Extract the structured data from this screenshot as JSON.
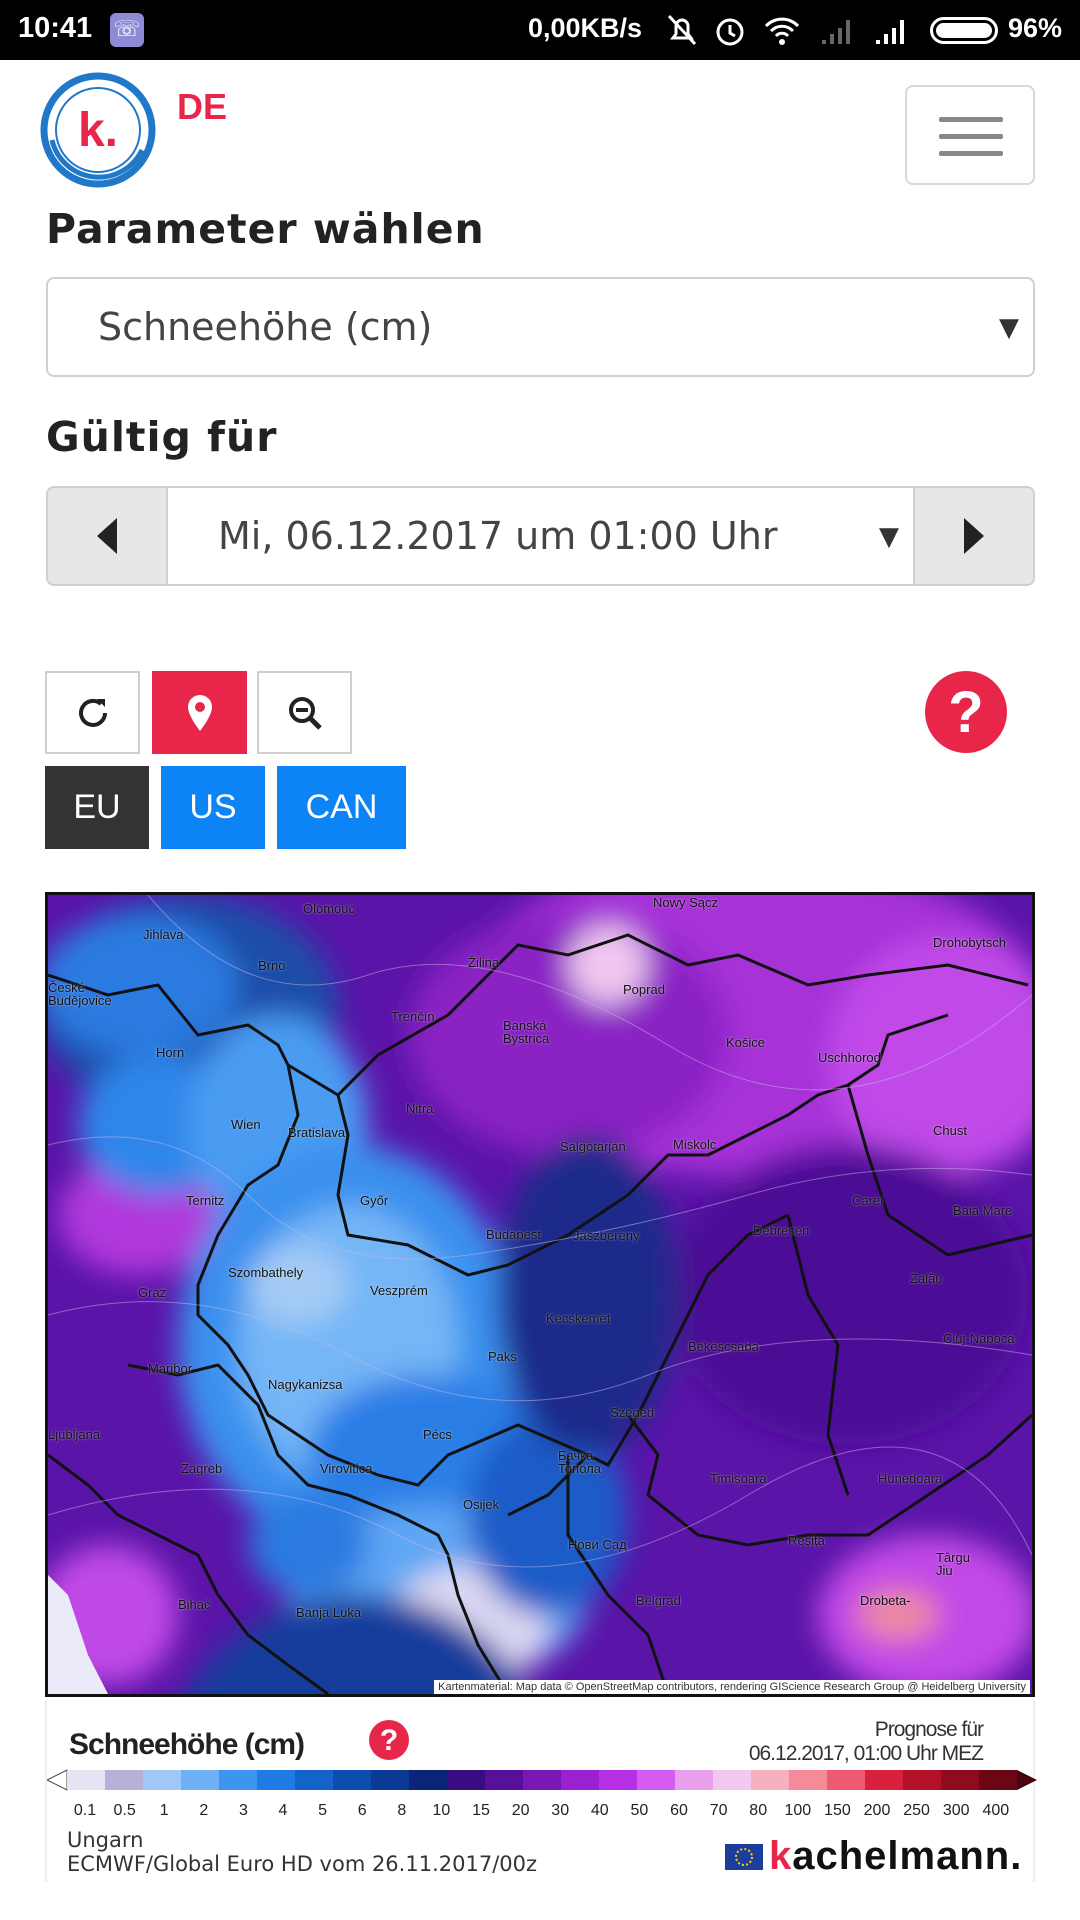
{
  "status_bar": {
    "time": "10:41",
    "data_rate": "0,00KB/s",
    "battery": "96%"
  },
  "header": {
    "logo_letter": "k.",
    "language": "DE"
  },
  "parameter": {
    "label": "Parameter wählen",
    "selected": "Schneehöhe (cm)"
  },
  "valid_for": {
    "label": "Gültig für",
    "selected": "Mi, 06.12.2017 um 01:00 Uhr"
  },
  "toolbar": {
    "help_symbol": "?"
  },
  "regions": {
    "eu": "EU",
    "us": "US",
    "can": "CAN"
  },
  "map": {
    "credit": "Kartenmaterial: Map data © OpenStreetMap contributors, rendering GIScience Research Group @ Heidelberg University",
    "cities": [
      "Olomouc",
      "Nowy Sącz",
      "Jihlava",
      "Brno",
      "Žilina",
      "Drohobytsch",
      "Poprad",
      "České Budějovice",
      "Trenčín",
      "Banská Bystrica",
      "Košice",
      "Uschhorod",
      "Horn",
      "Wien",
      "Bratislava",
      "Nitra",
      "Chust",
      "Salgótarján",
      "Miskolc",
      "Ternitz",
      "Győr",
      "Baia Mare",
      "Carei",
      "Budapest",
      "Jászberény",
      "Debrecen",
      "Szombathely",
      "Zalău",
      "Graz",
      "Veszprém",
      "Kecskemét",
      "Cluj-Napoca",
      "Maribor",
      "Paks",
      "Békéscsaba",
      "Nagykanizsa",
      "Szeged",
      "Ljubljana",
      "Pécs",
      "Zagreb",
      "Virovitica",
      "Бачка Топола",
      "Timişoara",
      "Hunedoara",
      "Osijek",
      "Нови Сад",
      "Reşiţa",
      "Târgu Jiu",
      "Bihać",
      "Banja Luka",
      "Belgrad",
      "Drobeta-"
    ]
  },
  "legend": {
    "title": "Schneehöhe (cm)",
    "forecast_label": "Prognose für",
    "forecast_time": "06.12.2017, 01:00 Uhr MEZ",
    "ticks": [
      "0.1",
      "0.5",
      "1",
      "2",
      "3",
      "4",
      "5",
      "6",
      "8",
      "10",
      "15",
      "20",
      "30",
      "40",
      "50",
      "60",
      "70",
      "80",
      "100",
      "150",
      "200",
      "250",
      "300",
      "400"
    ],
    "colors": [
      "#e6e3f5",
      "#b8b0d8",
      "#9fc8f7",
      "#6eb0f5",
      "#3d95ef",
      "#1f7be3",
      "#1463c9",
      "#0e4db0",
      "#0a3a93",
      "#0a2478",
      "#3a0c82",
      "#56109a",
      "#7a18b5",
      "#9a20d0",
      "#b830e6",
      "#d45cf0",
      "#e8a0ec",
      "#f3c8ef",
      "#f6b0c0",
      "#f58a99",
      "#ee5a70",
      "#d8203c",
      "#b5102a",
      "#900a20",
      "#6a0616"
    ],
    "region": "Ungarn",
    "model": "ECMWF/Global Euro HD vom 26.11.2017/00z",
    "brand": "achelmann.",
    "brand_k": "k"
  }
}
